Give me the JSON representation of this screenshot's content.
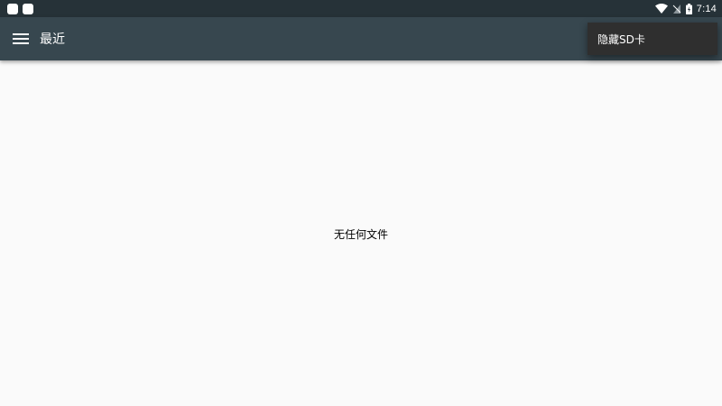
{
  "status_bar": {
    "time": "7:14",
    "icons": [
      "notification-icon",
      "notification-icon",
      "wifi-icon",
      "no-sim-icon",
      "battery-charging-icon"
    ]
  },
  "app_bar": {
    "menu_icon": "menu-icon",
    "title": "最近"
  },
  "overflow_menu": {
    "items": [
      {
        "label": "隐藏SD卡"
      }
    ]
  },
  "content": {
    "empty_message": "无任何文件"
  },
  "colors": {
    "status_bar_bg": "#263238",
    "app_bar_bg": "#37474f",
    "page_bg": "#fafafa",
    "menu_bg": "#2f2f2f"
  }
}
